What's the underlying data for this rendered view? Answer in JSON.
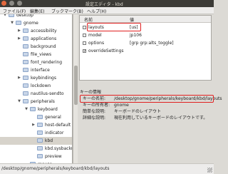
{
  "window": {
    "title": "設定エディタ - kbd"
  },
  "menu": [
    "ファイル(F)",
    "編集(E)",
    "ブックマーク(B)",
    "ヘルプ(H)"
  ],
  "tree": {
    "items": [
      {
        "label": "desktop",
        "arrow": "down",
        "indent": 0
      },
      {
        "label": "gnome",
        "arrow": "down",
        "indent": 1
      },
      {
        "label": "accessibility",
        "arrow": "right",
        "indent": 2
      },
      {
        "label": "applications",
        "arrow": "right",
        "indent": 2
      },
      {
        "label": "background",
        "arrow": "",
        "indent": 2
      },
      {
        "label": "file_views",
        "arrow": "",
        "indent": 2
      },
      {
        "label": "font_rendering",
        "arrow": "",
        "indent": 2
      },
      {
        "label": "interface",
        "arrow": "",
        "indent": 2
      },
      {
        "label": "keybindings",
        "arrow": "right",
        "indent": 2
      },
      {
        "label": "lockdown",
        "arrow": "",
        "indent": 2
      },
      {
        "label": "nautilus-sendto",
        "arrow": "",
        "indent": 2
      },
      {
        "label": "peripherals",
        "arrow": "down",
        "indent": 2
      },
      {
        "label": "keyboard",
        "arrow": "down",
        "indent": 3
      },
      {
        "label": "general",
        "arrow": "",
        "indent": 4
      },
      {
        "label": "host-default",
        "arrow": "right",
        "indent": 4
      },
      {
        "label": "indicator",
        "arrow": "",
        "indent": 4
      },
      {
        "label": "kbd",
        "arrow": "",
        "indent": 4
      },
      {
        "label": "kbd.sysbackup",
        "arrow": "",
        "indent": 4
      },
      {
        "label": "preview",
        "arrow": "",
        "indent": 4
      },
      {
        "label": "mouse",
        "arrow": "",
        "indent": 3
      }
    ],
    "selected_index": 16
  },
  "list": {
    "headers": {
      "name": "名前",
      "value": "値"
    },
    "rows": [
      {
        "name": "layouts",
        "value": "[us]"
      },
      {
        "name": "model",
        "value": "jp106"
      },
      {
        "name": "options",
        "value": "[grp    grp:alts_toggle]"
      },
      {
        "name": "overrideSettings",
        "value": "✓"
      }
    ]
  },
  "info": {
    "title": "キーの情報",
    "rows": [
      {
        "key": "キーの名前:",
        "value": "/desktop/gnome/peripherals/keyboard/kbd/layouts"
      },
      {
        "key": "キーの所有者:",
        "value": "gnome"
      },
      {
        "key": "簡単な説明:",
        "value": "キーボードのレイアウト"
      },
      {
        "key": "詳細な説明:",
        "value": "現在利用しているキーボードのレイアウトです。"
      }
    ]
  },
  "status": {
    "path": "/desktop/gnome/peripherals/keyboard/kbd/layouts"
  }
}
